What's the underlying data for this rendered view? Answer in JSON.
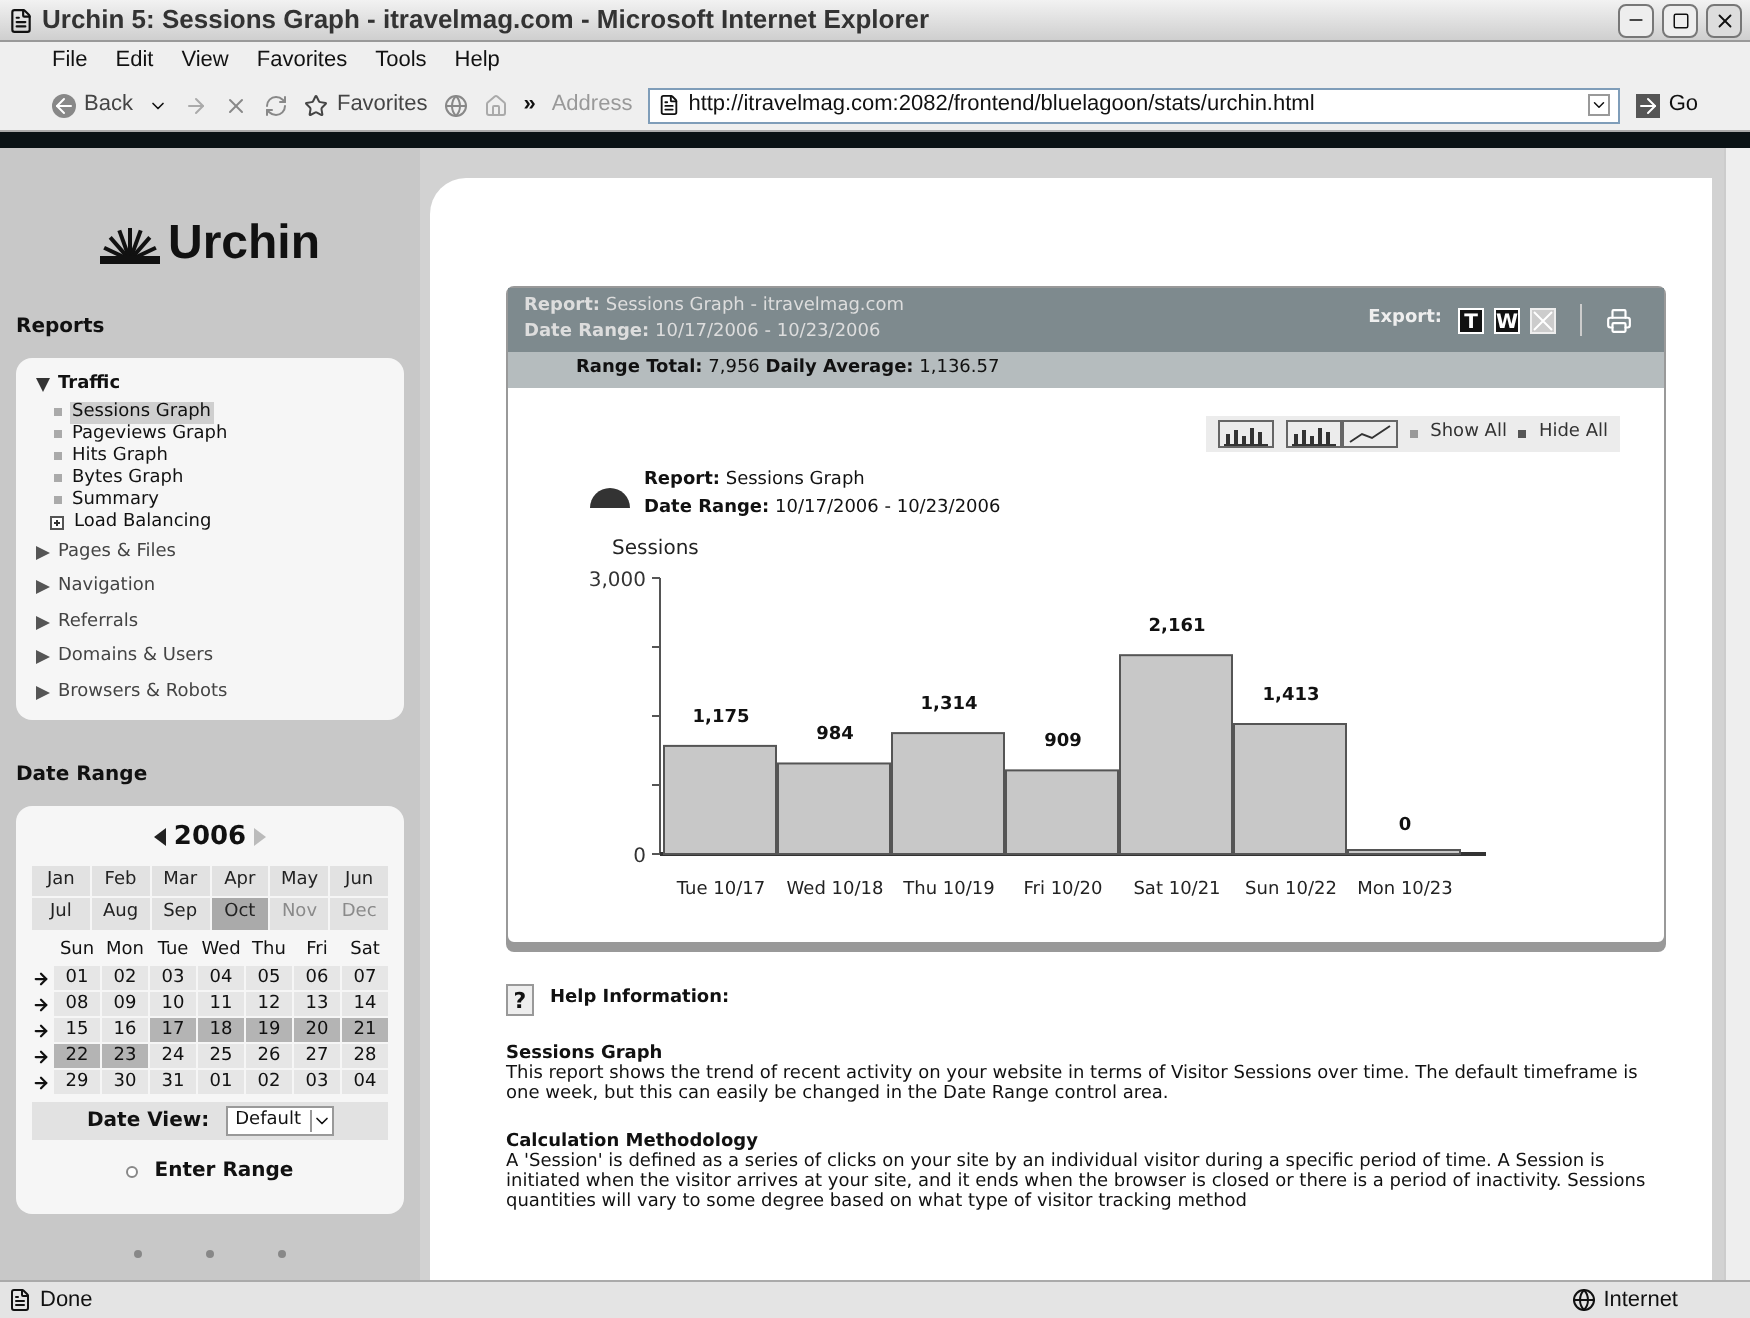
{
  "window": {
    "title": "Urchin 5: Sessions Graph - itravelmag.com - Microsoft Internet Explorer"
  },
  "menu": [
    "File",
    "Edit",
    "View",
    "Favorites",
    "Tools",
    "Help"
  ],
  "toolbar": {
    "back": "Back",
    "favorites": "Favorites",
    "more": "»",
    "address_label": "Address",
    "url": "http://itravelmag.com:2082/frontend/bluelagoon/stats/urchin.html",
    "go": "Go"
  },
  "sidebar": {
    "logo": "Urchin",
    "reports_title": "Reports",
    "tree": [
      {
        "label": "Traffic",
        "expanded": true,
        "children": [
          {
            "kind": "report",
            "label": "Sessions Graph",
            "selected": true
          },
          {
            "kind": "report",
            "label": "Pageviews Graph",
            "selected": false
          },
          {
            "kind": "report",
            "label": "Hits Graph",
            "selected": false
          },
          {
            "kind": "report",
            "label": "Bytes Graph",
            "selected": false
          },
          {
            "kind": "report",
            "label": "Summary",
            "selected": false
          },
          {
            "kind": "group",
            "label": "Load Balancing",
            "selected": false
          }
        ]
      },
      {
        "label": "Pages & Files",
        "expanded": false
      },
      {
        "label": "Navigation",
        "expanded": false
      },
      {
        "label": "Referrals",
        "expanded": false
      },
      {
        "label": "Domains & Users",
        "expanded": false
      },
      {
        "label": "Browsers & Robots",
        "expanded": false
      }
    ],
    "date_range_title": "Date Range",
    "year": "2006",
    "months": [
      {
        "label": "Jan",
        "selected": false,
        "disabled": false
      },
      {
        "label": "Feb",
        "selected": false,
        "disabled": false
      },
      {
        "label": "Mar",
        "selected": false,
        "disabled": false
      },
      {
        "label": "Apr",
        "selected": false,
        "disabled": false
      },
      {
        "label": "May",
        "selected": false,
        "disabled": false
      },
      {
        "label": "Jun",
        "selected": false,
        "disabled": false
      },
      {
        "label": "Jul",
        "selected": false,
        "disabled": false
      },
      {
        "label": "Aug",
        "selected": false,
        "disabled": false
      },
      {
        "label": "Sep",
        "selected": false,
        "disabled": false
      },
      {
        "label": "Oct",
        "selected": true,
        "disabled": false
      },
      {
        "label": "Nov",
        "selected": false,
        "disabled": true
      },
      {
        "label": "Dec",
        "selected": false,
        "disabled": true
      }
    ],
    "weekdays": [
      "Sun",
      "Mon",
      "Tue",
      "Wed",
      "Thu",
      "Fri",
      "Sat"
    ],
    "weeks": [
      [
        {
          "day": "01",
          "selected": false
        },
        {
          "day": "02",
          "selected": false
        },
        {
          "day": "03",
          "selected": false
        },
        {
          "day": "04",
          "selected": false
        },
        {
          "day": "05",
          "selected": false
        },
        {
          "day": "06",
          "selected": false
        },
        {
          "day": "07",
          "selected": false
        }
      ],
      [
        {
          "day": "08",
          "selected": false
        },
        {
          "day": "09",
          "selected": false
        },
        {
          "day": "10",
          "selected": false
        },
        {
          "day": "11",
          "selected": false
        },
        {
          "day": "12",
          "selected": false
        },
        {
          "day": "13",
          "selected": false
        },
        {
          "day": "14",
          "selected": false
        }
      ],
      [
        {
          "day": "15",
          "selected": false
        },
        {
          "day": "16",
          "selected": false
        },
        {
          "day": "17",
          "selected": true
        },
        {
          "day": "18",
          "selected": true
        },
        {
          "day": "19",
          "selected": true
        },
        {
          "day": "20",
          "selected": true
        },
        {
          "day": "21",
          "selected": true
        }
      ],
      [
        {
          "day": "22",
          "selected": true
        },
        {
          "day": "23",
          "selected": true
        },
        {
          "day": "24",
          "selected": false
        },
        {
          "day": "25",
          "selected": false
        },
        {
          "day": "26",
          "selected": false
        },
        {
          "day": "27",
          "selected": false
        },
        {
          "day": "28",
          "selected": false
        }
      ],
      [
        {
          "day": "29",
          "selected": false
        },
        {
          "day": "30",
          "selected": false
        },
        {
          "day": "31",
          "selected": false
        },
        {
          "day": "01",
          "selected": false
        },
        {
          "day": "02",
          "selected": false
        },
        {
          "day": "03",
          "selected": false
        },
        {
          "day": "04",
          "selected": false
        }
      ]
    ],
    "date_view_label": "Date View:",
    "date_view_value": "Default",
    "enter_range": {
      "label": "Enter Range",
      "checked": false
    }
  },
  "report": {
    "header_report": "**Report:** Sessions Graph - itravelmag.com",
    "header_range": "**Date Range:** 10/17/2006 - 10/23/2006",
    "export_label": "Export:",
    "export_buttons": [
      "T",
      "W"
    ],
    "totals": "**Range Total:** 7,956 **Daily Average:** 1,136.57",
    "show_all": "Show All",
    "hide_all": "Hide All",
    "graph_report": "**Report:** Sessions Graph",
    "graph_range": "**Date Range:** 10/17/2006 - 10/23/2006",
    "chart_data": {
      "type": "bar",
      "categories": [
        "Tue 10/17",
        "Wed 10/18",
        "Thu 10/19",
        "Fri 10/20",
        "Sat 10/21",
        "Sun 10/22",
        "Mon 10/23"
      ],
      "series": [
        {
          "name": "Sessions",
          "color": "#c8c8c8",
          "values": [
            1175,
            984,
            1314,
            909,
            2161,
            1413,
            0
          ]
        }
      ],
      "value_labels": [
        "1,175",
        "984",
        "1,314",
        "909",
        "2,161",
        "1,413",
        "0"
      ],
      "ylim": [
        0,
        3000
      ],
      "yticks": [
        0,
        {
          "value": 3000,
          "label": "3,000"
        }
      ]
    }
  },
  "help": {
    "icon": "?",
    "title": "Help Information:",
    "sections": [
      {
        "heading": "Sessions Graph",
        "body": "This report shows the trend of recent activity on your website in terms of Visitor Sessions over time. The default timeframe is one week, but this can easily be changed in the Date Range control area."
      },
      {
        "heading": "Calculation Methodology",
        "body": "A 'Session' is defined as a series of clicks on your site by an individual visitor during a specific period of time. A Session is initiated when the visitor arrives at your site, and it ends when the browser is closed or there is a period of inactivity. Sessions quantities will vary to some degree based on what type of visitor tracking method"
      }
    ]
  },
  "status_bar": {
    "text": "Done",
    "zone": "Internet"
  }
}
